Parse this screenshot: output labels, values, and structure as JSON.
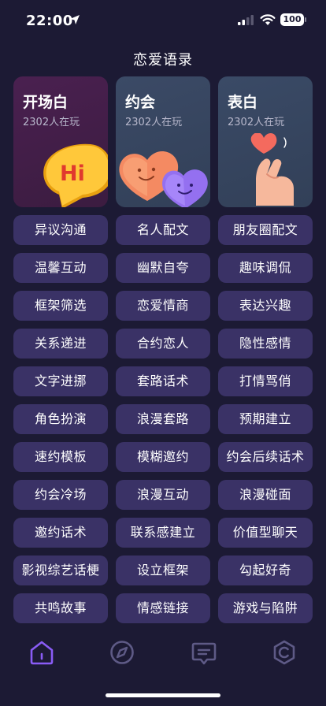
{
  "status_bar": {
    "time": "22:00",
    "battery": "100"
  },
  "page_title": "恋爱语录",
  "feature_cards": [
    {
      "title": "开场白",
      "count": "2302人在玩",
      "art_text": "Hi"
    },
    {
      "title": "约会",
      "count": "2302人在玩"
    },
    {
      "title": "表白",
      "count": "2302人在玩"
    }
  ],
  "chips": [
    "异议沟通",
    "名人配文",
    "朋友圈配文",
    "温馨互动",
    "幽默自夸",
    "趣味调侃",
    "框架筛选",
    "恋爱情商",
    "表达兴趣",
    "关系递进",
    "合约恋人",
    "隐性感情",
    "文字进挪",
    "套路话术",
    "打情骂俏",
    "角色扮演",
    "浪漫套路",
    "预期建立",
    "速约模板",
    "模糊邀约",
    "约会后续话术",
    "约会冷场",
    "浪漫互动",
    "浪漫碰面",
    "邀约话术",
    "联系感建立",
    "价值型聊天",
    "影视综艺话梗",
    "设立框架",
    "勾起好奇",
    "共鸣故事",
    "情感链接",
    "游戏与陷阱"
  ],
  "tabs": [
    {
      "name": "home-icon",
      "active": true
    },
    {
      "name": "compass-icon",
      "active": false
    },
    {
      "name": "message-icon",
      "active": false
    },
    {
      "name": "profile-icon",
      "active": false
    }
  ],
  "colors": {
    "background": "#1c1a34",
    "chip": "#3a3266",
    "accent": "#8a5cf6",
    "tab_inactive": "#5e5a86"
  }
}
